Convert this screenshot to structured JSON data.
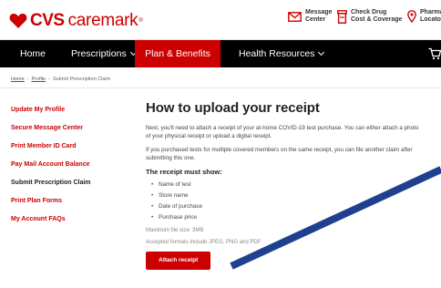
{
  "brand": {
    "cvs": "CVS",
    "caremark": "caremark",
    "reg": "®"
  },
  "util": {
    "message_center": [
      "Message",
      "Center"
    ],
    "check_drug": [
      "Check Drug",
      "Cost & Coverage"
    ],
    "pharmacy_locator": [
      "Pharma",
      "Locato"
    ]
  },
  "nav": {
    "home": "Home",
    "prescriptions": "Prescriptions",
    "plan_benefits": "Plan & Benefits",
    "health_resources": "Health Resources"
  },
  "breadcrumb": [
    "Home",
    "Profile",
    "Submit Prescription Claim"
  ],
  "sidebar": {
    "items": [
      {
        "label": "Update My Profile"
      },
      {
        "label": "Secure Message Center"
      },
      {
        "label": "Print Member ID Card"
      },
      {
        "label": "Pay Mail Account Balance"
      },
      {
        "label": "Submit Prescription Claim"
      },
      {
        "label": "Print Plan Forms"
      },
      {
        "label": "My Account FAQs"
      }
    ]
  },
  "main": {
    "title": "How to upload your receipt",
    "para1": "Next, you'll need to attach a receipt of your at-home COVID-19 test purchase. You can either attach a photo of your physical receipt or upload a digital receipt.",
    "para2": "If you purchased tests for multiple covered members on the same receipt, you can file another claim after submitting this one.",
    "subhead": "The receipt must show:",
    "bullets": [
      "Name of test",
      "Store name",
      "Date of purchase",
      "Purchase price"
    ],
    "max_size": "Maximum file size: 3MB",
    "formats": "Accepted formats include JPEG, PNG and PDF",
    "attach_button": "Attach receipt"
  },
  "colors": {
    "brand_red": "#cc0000",
    "nav_black": "#000000",
    "arrow_blue": "#1f3f8f"
  }
}
